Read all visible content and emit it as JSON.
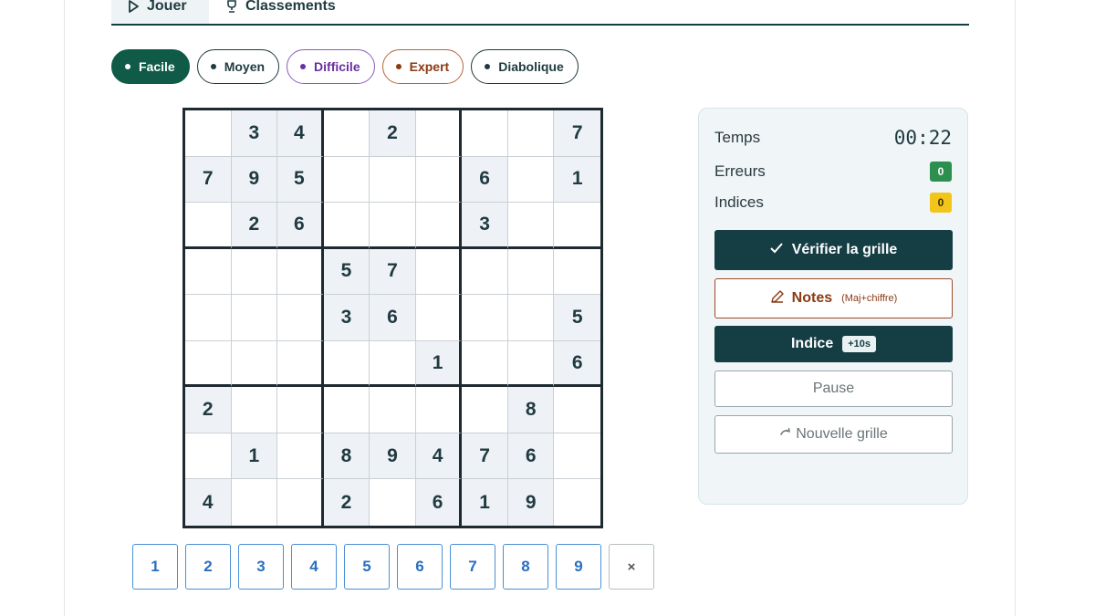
{
  "tabs": [
    {
      "label": "Jouer",
      "icon": "play-icon",
      "active": true
    },
    {
      "label": "Classements",
      "icon": "trophy-icon",
      "active": false
    }
  ],
  "difficulties": [
    {
      "label": "Facile",
      "selected": true,
      "color": "#0f5b47"
    },
    {
      "label": "Moyen",
      "selected": false,
      "color": "#1f3a40"
    },
    {
      "label": "Difficile",
      "selected": false,
      "color": "#6a2fa0"
    },
    {
      "label": "Expert",
      "selected": false,
      "color": "#8a3b12"
    },
    {
      "label": "Diabolique",
      "selected": false,
      "color": "#1f3a40"
    }
  ],
  "grid": [
    [
      "",
      "3",
      "4",
      "",
      "2",
      "",
      "",
      "",
      "7"
    ],
    [
      "7",
      "9",
      "5",
      "",
      "",
      "",
      "6",
      "",
      "1"
    ],
    [
      "",
      "2",
      "6",
      "",
      "",
      "",
      "3",
      "",
      ""
    ],
    [
      "",
      "",
      "",
      "5",
      "7",
      "",
      "",
      "",
      ""
    ],
    [
      "",
      "",
      "",
      "3",
      "6",
      "",
      "",
      "",
      "5"
    ],
    [
      "",
      "",
      "",
      "",
      "",
      "1",
      "",
      "",
      "6"
    ],
    [
      "2",
      "",
      "",
      "",
      "",
      "",
      "",
      "8",
      ""
    ],
    [
      "",
      "1",
      "",
      "8",
      "9",
      "4",
      "7",
      "6",
      ""
    ],
    [
      "4",
      "",
      "",
      "2",
      "",
      "6",
      "1",
      "9",
      ""
    ]
  ],
  "numpad": [
    "1",
    "2",
    "3",
    "4",
    "5",
    "6",
    "7",
    "8",
    "9"
  ],
  "numpad_erase": "×",
  "panel": {
    "time_label": "Temps",
    "time_value": "00:22",
    "errors_label": "Erreurs",
    "errors_value": "0",
    "hints_label": "Indices",
    "hints_value": "0",
    "verify_label": "Vérifier la grille",
    "notes_label": "Notes",
    "notes_hint": "(Maj+chiffre)",
    "hint_label": "Indice",
    "hint_penalty": "+10s",
    "pause_label": "Pause",
    "new_grid_label": "Nouvelle grille"
  },
  "colors": {
    "primary": "#153d44",
    "accent_green": "#0f5b47",
    "error_badge": "#2d8f4e",
    "hint_badge": "#f2c51b",
    "notes": "#8a3b12",
    "numpad_blue": "#2a6fc0"
  }
}
